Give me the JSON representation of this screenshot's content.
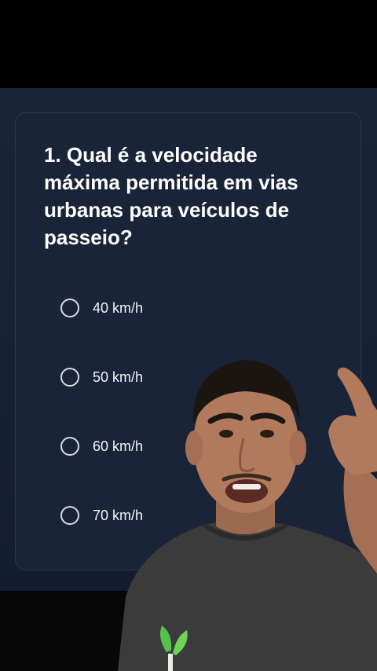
{
  "quiz": {
    "question": "1. Qual é a velocidade máxima permitida em vias urbanas para veículos de passeio?",
    "options": [
      {
        "label": "40 km/h",
        "selected": false
      },
      {
        "label": "50 km/h",
        "selected": false
      },
      {
        "label": "60 km/h",
        "selected": false
      },
      {
        "label": "70 km/h",
        "selected": false
      }
    ]
  },
  "colors": {
    "page_background": "#000000",
    "stage_background": "#19233a",
    "card_background": "#1a2439",
    "card_border": "#2b3650",
    "text": "#ffffff",
    "radio_ring": "#d9dde6",
    "shirt": "#3a3b3a",
    "skin": "#b17a5c",
    "hair": "#1c1613"
  },
  "icons": [
    "radio-unchecked-icon",
    "leaf-logo-icon"
  ]
}
